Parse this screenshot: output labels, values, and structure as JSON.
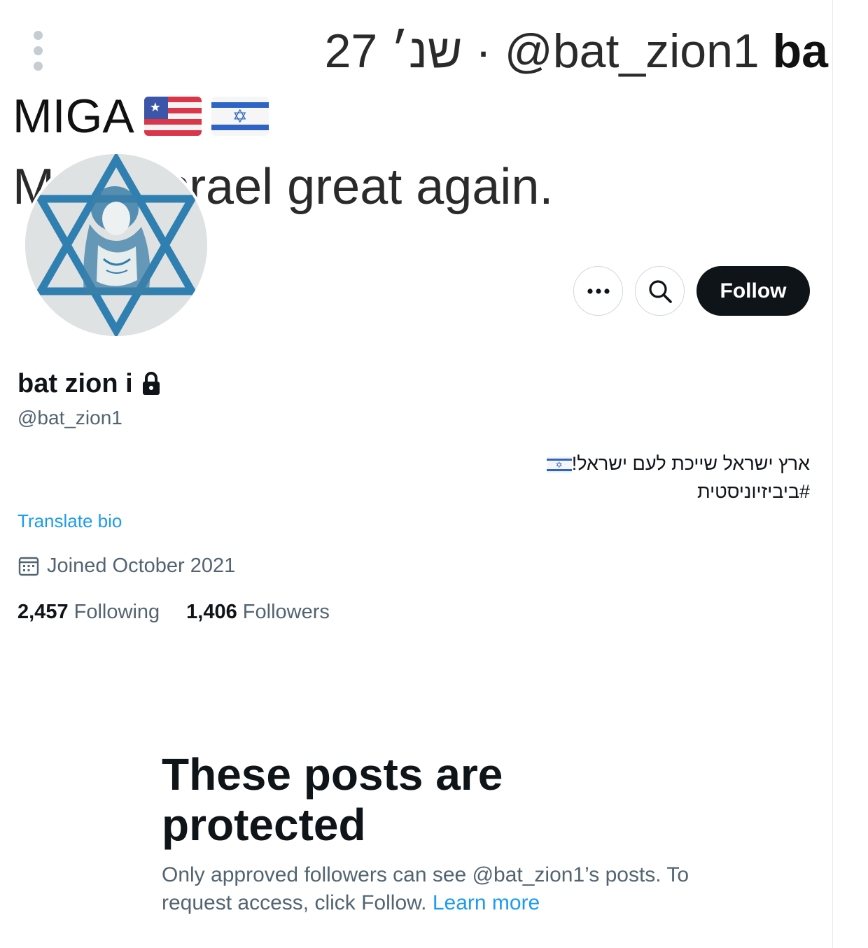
{
  "banner": {
    "top_line_bold": "ba",
    "top_line_text": "27 שנ׳ · @bat_zion1 ",
    "miga_text": "MIGA",
    "tagline": "Make Israel great again."
  },
  "profile": {
    "display_name": "bat zion i",
    "handle": "@bat_zion1",
    "bio_line1": "ארץ ישראל שייכת לעם ישראל!",
    "bio_line2": "#ביביזיוניסטית",
    "translate_label": "Translate bio",
    "joined": "Joined October 2021",
    "following_count": "2,457",
    "following_label": "Following",
    "followers_count": "1,406",
    "followers_label": "Followers"
  },
  "actions": {
    "more_icon": "more-horizontal-icon",
    "search_icon": "search-icon",
    "follow_label": "Follow"
  },
  "protected": {
    "title": "These posts are protected",
    "description": "Only approved followers can see @bat_zion1’s posts. To request access, click Follow.",
    "learn_more": "Learn more"
  },
  "colors": {
    "accent": "#1d9bf0",
    "text_primary": "#0f1419",
    "text_secondary": "#536471",
    "follow_bg": "#0f1419"
  }
}
